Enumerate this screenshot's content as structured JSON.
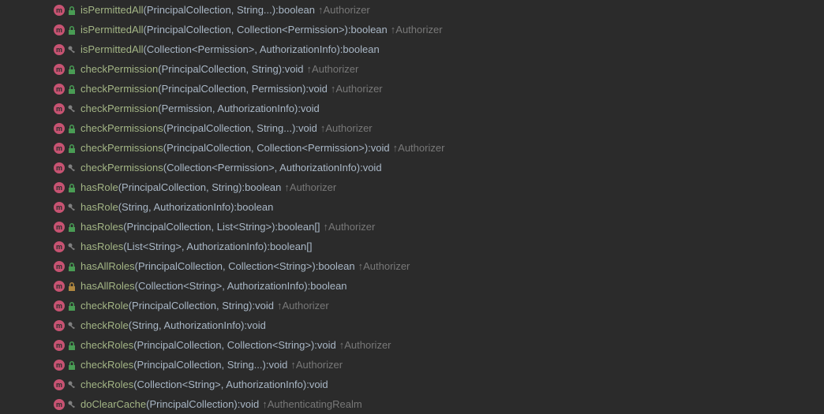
{
  "rows": [
    {
      "mod": "green-lock",
      "name": "isPermittedAll",
      "params": "PrincipalCollection, String...",
      "ret": "boolean",
      "override": "Authorizer"
    },
    {
      "mod": "green-lock",
      "name": "isPermittedAll",
      "params": "PrincipalCollection, Collection<Permission>",
      "ret": "boolean",
      "override": "Authorizer"
    },
    {
      "mod": "key",
      "name": "isPermittedAll",
      "params": "Collection<Permission>, AuthorizationInfo",
      "ret": "boolean",
      "override": null
    },
    {
      "mod": "green-lock",
      "name": "checkPermission",
      "params": "PrincipalCollection, String",
      "ret": "void",
      "override": "Authorizer"
    },
    {
      "mod": "green-lock",
      "name": "checkPermission",
      "params": "PrincipalCollection, Permission",
      "ret": "void",
      "override": "Authorizer"
    },
    {
      "mod": "key",
      "name": "checkPermission",
      "params": "Permission, AuthorizationInfo",
      "ret": "void",
      "override": null
    },
    {
      "mod": "green-lock",
      "name": "checkPermissions",
      "params": "PrincipalCollection, String...",
      "ret": "void",
      "override": "Authorizer"
    },
    {
      "mod": "green-lock",
      "name": "checkPermissions",
      "params": "PrincipalCollection, Collection<Permission>",
      "ret": "void",
      "override": "Authorizer"
    },
    {
      "mod": "key",
      "name": "checkPermissions",
      "params": "Collection<Permission>, AuthorizationInfo",
      "ret": "void",
      "override": null
    },
    {
      "mod": "green-lock",
      "name": "hasRole",
      "params": "PrincipalCollection, String",
      "ret": "boolean",
      "override": "Authorizer"
    },
    {
      "mod": "key",
      "name": "hasRole",
      "params": "String, AuthorizationInfo",
      "ret": "boolean",
      "override": null
    },
    {
      "mod": "green-lock",
      "name": "hasRoles",
      "params": "PrincipalCollection, List<String>",
      "ret": "boolean[]",
      "override": "Authorizer"
    },
    {
      "mod": "key",
      "name": "hasRoles",
      "params": "List<String>, AuthorizationInfo",
      "ret": "boolean[]",
      "override": null
    },
    {
      "mod": "green-lock",
      "name": "hasAllRoles",
      "params": "PrincipalCollection, Collection<String>",
      "ret": "boolean",
      "override": "Authorizer"
    },
    {
      "mod": "orange-lock",
      "name": "hasAllRoles",
      "params": "Collection<String>, AuthorizationInfo",
      "ret": "boolean",
      "override": null
    },
    {
      "mod": "green-lock",
      "name": "checkRole",
      "params": "PrincipalCollection, String",
      "ret": "void",
      "override": "Authorizer"
    },
    {
      "mod": "key",
      "name": "checkRole",
      "params": "String, AuthorizationInfo",
      "ret": "void",
      "override": null
    },
    {
      "mod": "green-lock",
      "name": "checkRoles",
      "params": "PrincipalCollection, Collection<String>",
      "ret": "void",
      "override": "Authorizer"
    },
    {
      "mod": "green-lock",
      "name": "checkRoles",
      "params": "PrincipalCollection, String...",
      "ret": "void",
      "override": "Authorizer"
    },
    {
      "mod": "key",
      "name": "checkRoles",
      "params": "Collection<String>, AuthorizationInfo",
      "ret": "void",
      "override": null
    },
    {
      "mod": "key",
      "name": "doClearCache",
      "params": "PrincipalCollection",
      "ret": "void",
      "override": "AuthenticatingRealm"
    }
  ],
  "icons": {
    "m_letter": "m",
    "arrow_up": "↑"
  }
}
